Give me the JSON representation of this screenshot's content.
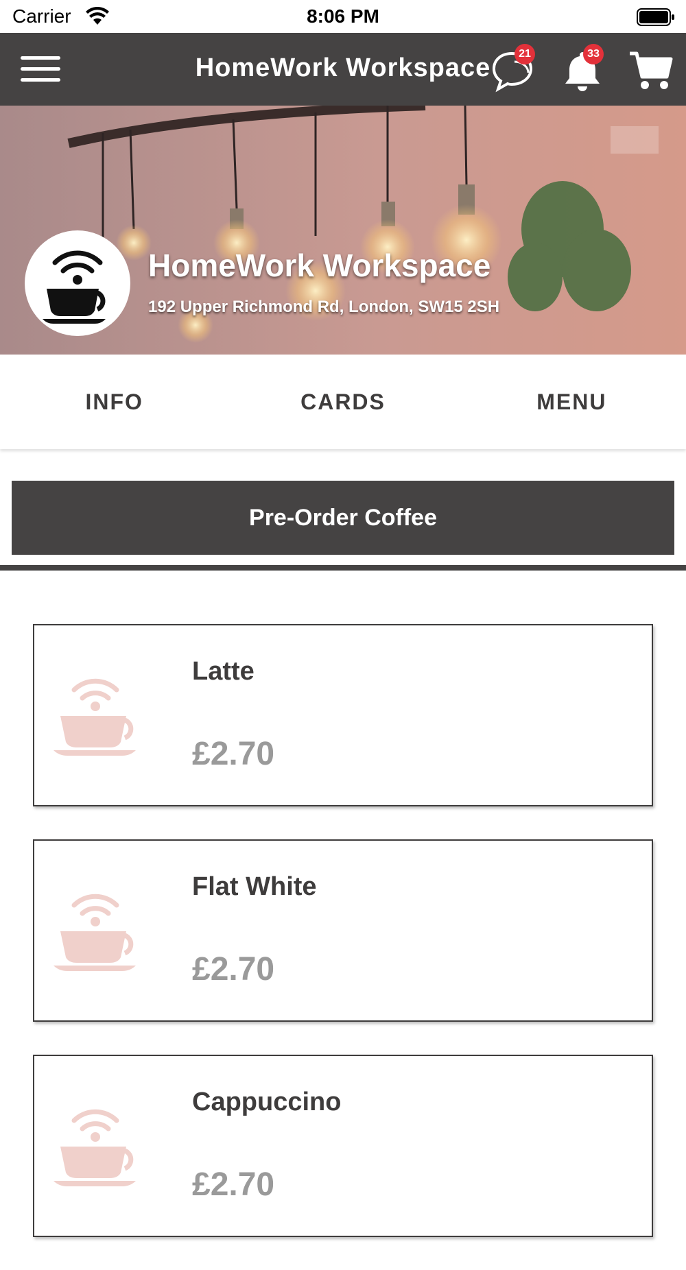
{
  "status_bar": {
    "carrier": "Carrier",
    "time": "8:06 PM"
  },
  "navbar": {
    "title": "HomeWork Workspace",
    "chat_badge": "21",
    "notifications_badge": "33"
  },
  "venue": {
    "name": "HomeWork Workspace",
    "address": "192 Upper Richmond Rd, London, SW15 2SH"
  },
  "tabs": [
    {
      "label": "INFO"
    },
    {
      "label": "CARDS"
    },
    {
      "label": "MENU"
    }
  ],
  "preorder_label": "Pre-Order Coffee",
  "menu_items": [
    {
      "name": "Latte",
      "price": "£2.70"
    },
    {
      "name": "Flat White",
      "price": "£2.70"
    },
    {
      "name": "Cappuccino",
      "price": "£2.70"
    }
  ],
  "colors": {
    "header_bg": "#454343",
    "badge": "#e3313a",
    "item_icon": "#f0d0cb",
    "price_text": "#9a9a9a"
  }
}
